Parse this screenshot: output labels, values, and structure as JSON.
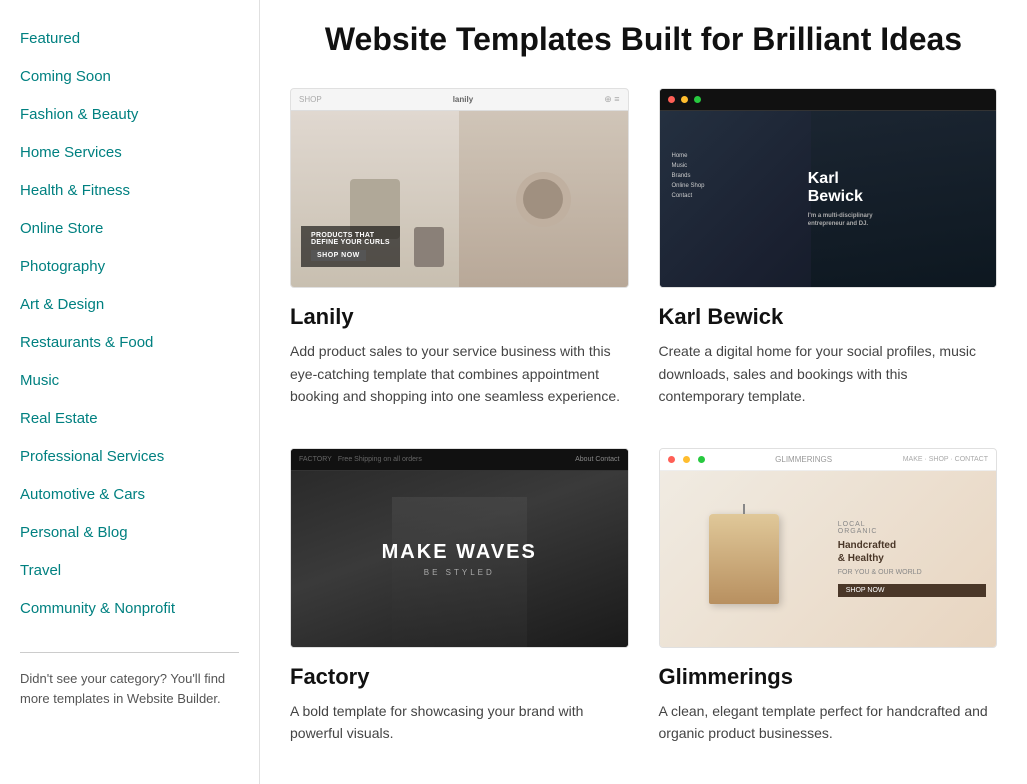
{
  "page": {
    "title": "Website Templates Built for Brilliant Ideas"
  },
  "sidebar": {
    "nav_items": [
      {
        "id": "featured",
        "label": "Featured"
      },
      {
        "id": "coming-soon",
        "label": "Coming Soon"
      },
      {
        "id": "fashion-beauty",
        "label": "Fashion & Beauty"
      },
      {
        "id": "home-services",
        "label": "Home Services"
      },
      {
        "id": "health-fitness",
        "label": "Health & Fitness"
      },
      {
        "id": "online-store",
        "label": "Online Store"
      },
      {
        "id": "photography",
        "label": "Photography"
      },
      {
        "id": "art-design",
        "label": "Art & Design"
      },
      {
        "id": "restaurants-food",
        "label": "Restaurants & Food"
      },
      {
        "id": "music",
        "label": "Music"
      },
      {
        "id": "real-estate",
        "label": "Real Estate"
      },
      {
        "id": "professional-services",
        "label": "Professional Services"
      },
      {
        "id": "automotive-cars",
        "label": "Automotive & Cars"
      },
      {
        "id": "personal-blog",
        "label": "Personal & Blog"
      },
      {
        "id": "travel",
        "label": "Travel"
      },
      {
        "id": "community-nonprofit",
        "label": "Community & Nonprofit"
      }
    ],
    "footer_text": "Didn't see your category? You'll find more templates in Website Builder."
  },
  "templates": [
    {
      "id": "lanily",
      "name": "Lanily",
      "description": "Add product sales to your service business with this eye-catching template that combines appointment booking and shopping into one seamless experience.",
      "thumb_type": "lanily",
      "overlay_text": "Products that define your curls",
      "button_text": "Shop Now"
    },
    {
      "id": "karl-bewick",
      "name": "Karl Bewick",
      "description": "Create a digital home for your social profiles, music downloads, sales and bookings with this contemporary template.",
      "thumb_type": "karl",
      "overlay_text": "Karl Bewick",
      "sub_text": "I'm a multi-disciplinary entrepreneur and DJ."
    },
    {
      "id": "factory",
      "name": "Factory",
      "description": "A bold template for showcasing your brand with powerful visuals.",
      "thumb_type": "factory",
      "overlay_text": "Make Waves",
      "sub_text": "BE STYLED"
    },
    {
      "id": "glimmerings",
      "name": "Glimmerings",
      "description": "A clean, elegant template perfect for handcrafted and organic product businesses.",
      "thumb_type": "glimmerings",
      "overlay_text": "Handcrafted & Healthy",
      "sub_text": "SHOP NOW"
    }
  ]
}
